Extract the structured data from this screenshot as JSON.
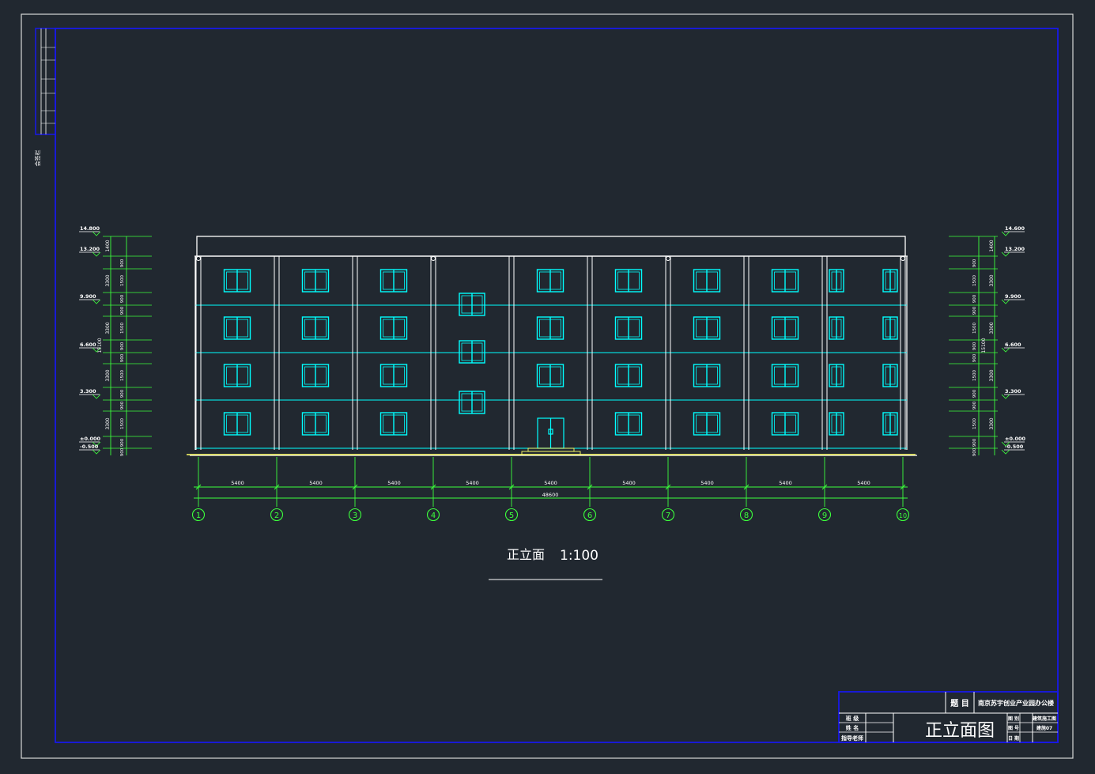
{
  "sheet_title": "正立面",
  "sheet_scale": "1:100",
  "left_strip_label": "会签栏",
  "levels_left": [
    "14.800",
    "13.200",
    "9.900",
    "6.600",
    "3.300",
    "±0.000",
    "-0.500"
  ],
  "levels_right": [
    "14.600",
    "13.200",
    "9.900",
    "6.600",
    "3.300",
    "±0.000",
    "-0.500"
  ],
  "vertical_dims_outer": [
    "1400",
    "3300",
    "3300",
    "3300",
    "3300",
    "15100"
  ],
  "vertical_dims_inner": [
    "900",
    "1500",
    "900",
    "900",
    "1500",
    "900",
    "900",
    "1500",
    "900",
    "900",
    "1500",
    "900",
    "900"
  ],
  "axes": [
    "1",
    "2",
    "3",
    "4",
    "5",
    "6",
    "7",
    "8",
    "9",
    "10"
  ],
  "bay_dims": [
    "5400",
    "5400",
    "5400",
    "5400",
    "5400",
    "5400",
    "5400",
    "5400",
    "5400"
  ],
  "total_dim": "48600",
  "title_block": {
    "project_label": "题 目",
    "project_name": "南京苏宇创业产业园办公楼",
    "drawing_name": "正立面图",
    "rows_left": [
      "班 级",
      "姓 名",
      "指导老师"
    ],
    "rows_right_labels": [
      "图 别",
      "图 号",
      "日 期"
    ],
    "rows_right_values": [
      "建筑施工图",
      "建施07",
      ""
    ]
  },
  "colors": {
    "background": "#212830",
    "outer_border": "#d8d8d8",
    "inner_border": "#1818e8",
    "building": "#ffffff",
    "windows": "#00ffff",
    "dimensions": "#3cff3c",
    "ground": "#ffff66"
  }
}
